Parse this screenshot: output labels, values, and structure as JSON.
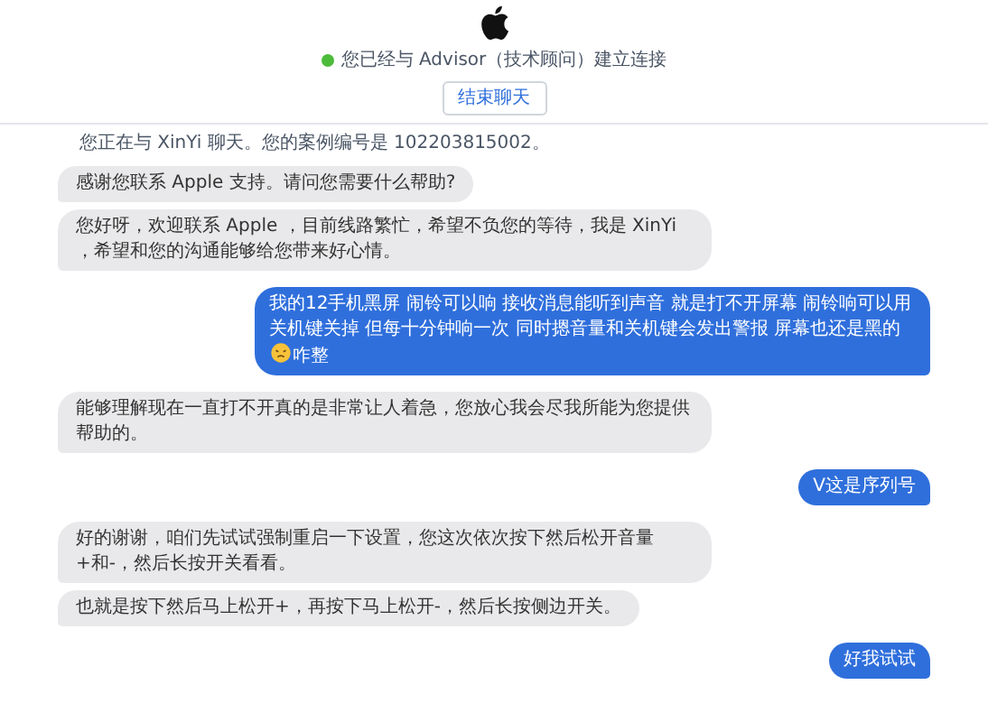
{
  "header": {
    "status": "您已经与 Advisor（技术顾问）建立连接",
    "connected": true,
    "end_button": "结束聊天"
  },
  "info": "您正在与 XinYi 聊天。您的案例编号是 102203815002。",
  "messages": [
    {
      "kind": "received",
      "text": "感谢您联系 Apple 支持。请问您需要什么帮助?"
    },
    {
      "kind": "received",
      "text": "您好呀，欢迎联系 Apple ，目前线路繁忙，希望不负您的等待，我是 XinYi ，希望和您的沟通能够给您带来好心情。"
    },
    {
      "kind": "sent",
      "text": "我的12手机黑屏 闹铃可以响 接收消息能听到声音 就是打不开屏幕 闹铃响可以用关机键关掉 但每十分钟响一次 同时摁音量和关机键会发出警报 屏幕也还是黑的",
      "after_emoji": "咋整"
    },
    {
      "kind": "received",
      "text": "能够理解现在一直打不开真的是非常让人着急，您放心我会尽我所能为您提供帮助的。"
    },
    {
      "kind": "sent",
      "text": "V这是序列号"
    },
    {
      "kind": "received",
      "text": "好的谢谢，咱们先试试强制重启一下设置，您这次依次按下然后松开音量+和-，然后长按开关看看。"
    },
    {
      "kind": "received",
      "text": "也就是按下然后马上松开+，再按下马上松开-，然后长按侧边开关。"
    },
    {
      "kind": "sent",
      "text": "好我试试"
    }
  ]
}
